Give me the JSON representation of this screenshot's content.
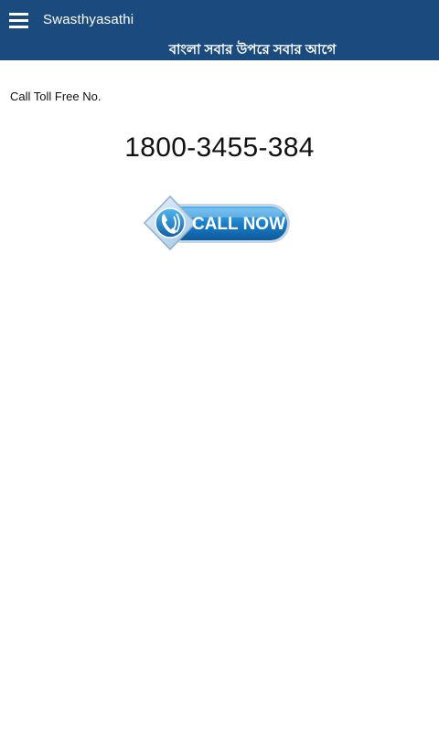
{
  "header": {
    "app_title": "Swasthyasathi",
    "tagline": "বাংলা সবার উপরে সবার আগে",
    "menu_icon": "hamburger-menu-icon",
    "bg_color": "#1b4b7e"
  },
  "main": {
    "toll_label": "Call Toll Free No.",
    "phone_number": "1800-3455-384",
    "call_button": {
      "label": "CALL NOW",
      "icon": "phone-icon",
      "color": "#1a7fc9"
    }
  }
}
